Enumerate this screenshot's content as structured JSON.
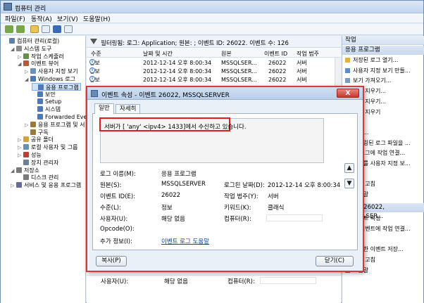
{
  "window": {
    "title": "컴퓨터 관리"
  },
  "menu": [
    "파일(F)",
    "동작(A)",
    "보기(V)",
    "도움말(H)"
  ],
  "tree": [
    {
      "label": "컴퓨터 관리(로컬)",
      "indent": 0,
      "exp": ""
    },
    {
      "label": "시스템 도구",
      "indent": 1,
      "exp": "◢"
    },
    {
      "label": "작업 스케줄러",
      "indent": 2,
      "exp": "▷"
    },
    {
      "label": "이벤트 뷰어",
      "indent": 2,
      "exp": "◢"
    },
    {
      "label": "사용자 지정 보기",
      "indent": 3,
      "exp": "▷"
    },
    {
      "label": "Windows 로그",
      "indent": 3,
      "exp": "◢"
    },
    {
      "label": "응용 프로그램",
      "indent": 4,
      "exp": ""
    },
    {
      "label": "보안",
      "indent": 4,
      "exp": ""
    },
    {
      "label": "Setup",
      "indent": 4,
      "exp": ""
    },
    {
      "label": "시스템",
      "indent": 4,
      "exp": ""
    },
    {
      "label": "Forwarded Event",
      "indent": 4,
      "exp": ""
    },
    {
      "label": "응용 프로그램 및 서",
      "indent": 3,
      "exp": "▷"
    },
    {
      "label": "구독",
      "indent": 3,
      "exp": ""
    },
    {
      "label": "공유 폴더",
      "indent": 2,
      "exp": "▷"
    },
    {
      "label": "로컬 사용자 및 그룹",
      "indent": 2,
      "exp": "▷"
    },
    {
      "label": "성능",
      "indent": 2,
      "exp": "▷"
    },
    {
      "label": "장치 관리자",
      "indent": 2,
      "exp": ""
    },
    {
      "label": "저장소",
      "indent": 1,
      "exp": "◢"
    },
    {
      "label": "디스크 관리",
      "indent": 2,
      "exp": ""
    },
    {
      "label": "서비스 및 응용 프로그램",
      "indent": 1,
      "exp": "▷"
    }
  ],
  "filter": {
    "text": "필터링됨: 로그: Application; 원본: ; 이벤트 ID: 26022. 이벤트 수: 126"
  },
  "columns": [
    "수준",
    "날짜 및 시간",
    "원본",
    "이벤트 ID",
    "작업 범주"
  ],
  "rows": [
    {
      "level": "정보",
      "date": "2012-12-14 오후 8:00:34",
      "source": "MSSQLSER...",
      "id": "26022",
      "category": "서버"
    },
    {
      "level": "정보",
      "date": "2012-12-14 오후 8:00:34",
      "source": "MSSQLSER...",
      "id": "26022",
      "category": "서버"
    },
    {
      "level": "정보",
      "date": "2012-12-14 오후 8:00:34",
      "source": "MSSQLSER...",
      "id": "26022",
      "category": "서버"
    }
  ],
  "bottom_fields": {
    "user_label": "사용자(U):",
    "user_value": "해당 없음",
    "computer_label": "컴퓨터(R):"
  },
  "actions": {
    "header": "작업",
    "section1": "응용 프로그램",
    "items1": [
      "저장된 로그 열기...",
      "사용자 지정 보기 만들...",
      "보기 가져오기...",
      "로그 지우기...",
      "필터 지우기...",
      "필터 지우기",
      "속성",
      "찾기...",
      "필터링된 로그 파일을 ...",
      "이 로그에 작업 연결...",
      "필터를 사용자 지정 보...",
      "보기",
      "새로 고침",
      "도움말"
    ],
    "section2": "이벤트 26022, MSSQLSER...",
    "items2": [
      "이벤트 속성",
      "이 이벤트에 작업 연결...",
      "복사",
      "선택한 이벤트 저장...",
      "새로 고침",
      "도움말"
    ]
  },
  "dialog": {
    "title": "이벤트 속성 - 이벤트 26022, MSSQLSERVER",
    "close": "X",
    "tabs": [
      "일반",
      "자세히"
    ],
    "message": "서버가 [ 'any' <ipv4> 1433]에서 수신하고 있습니다.",
    "fields": {
      "log_name_label": "로그 이름(M):",
      "log_name": "응용 프로그램",
      "source_label": "원본(S):",
      "source": "MSSQLSERVER",
      "logged_label": "로그된 날짜(D):",
      "logged": "2012-12-14 오후 8:00:34",
      "event_id_label": "이벤트 ID(E):",
      "event_id": "26022",
      "task_label": "작업 범주(Y):",
      "task": "서버",
      "level_label": "수준(L):",
      "level": "정보",
      "keywords_label": "키워드(K):",
      "keywords": "클래식",
      "user_label": "사용자(U):",
      "user": "해당 없음",
      "computer_label": "컴퓨터(R):",
      "opcode_label": "Opcode(O):",
      "more_info_label": "추가 정보(I):",
      "more_info_link": "이벤트 로그 도움말"
    },
    "copy_button": "복사(P)",
    "close_button": "닫기(C)"
  }
}
